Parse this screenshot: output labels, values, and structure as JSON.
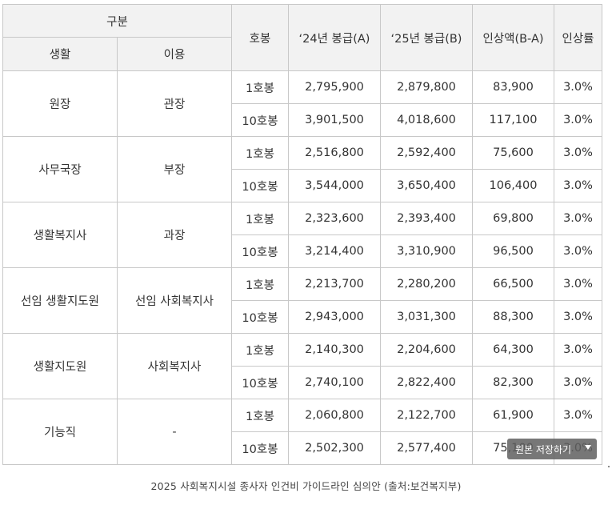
{
  "headers": {
    "group": "구분",
    "sub_life": "생활",
    "sub_use": "이용",
    "grade": "호봉",
    "pay_2024": "‘24년 봉급(A)",
    "pay_2025": "‘25년 봉급(B)",
    "increase": "인상액(B-A)",
    "rate": "인상률"
  },
  "rows": [
    {
      "life": "원장",
      "use": "관장",
      "steps": [
        {
          "grade": "1호봉",
          "a": "2,795,900",
          "b": "2,879,800",
          "inc": "83,900",
          "rate": "3.0%"
        },
        {
          "grade": "10호봉",
          "a": "3,901,500",
          "b": "4,018,600",
          "inc": "117,100",
          "rate": "3.0%"
        }
      ]
    },
    {
      "life": "사무국장",
      "use": "부장",
      "steps": [
        {
          "grade": "1호봉",
          "a": "2,516,800",
          "b": "2,592,400",
          "inc": "75,600",
          "rate": "3.0%"
        },
        {
          "grade": "10호봉",
          "a": "3,544,000",
          "b": "3,650,400",
          "inc": "106,400",
          "rate": "3.0%"
        }
      ]
    },
    {
      "life": "생활복지사",
      "use": "과장",
      "steps": [
        {
          "grade": "1호봉",
          "a": "2,323,600",
          "b": "2,393,400",
          "inc": "69,800",
          "rate": "3.0%"
        },
        {
          "grade": "10호봉",
          "a": "3,214,400",
          "b": "3,310,900",
          "inc": "96,500",
          "rate": "3.0%"
        }
      ]
    },
    {
      "life": "선임 생활지도원",
      "use": "선임 사회복지사",
      "steps": [
        {
          "grade": "1호봉",
          "a": "2,213,700",
          "b": "2,280,200",
          "inc": "66,500",
          "rate": "3.0%"
        },
        {
          "grade": "10호봉",
          "a": "2,943,000",
          "b": "3,031,300",
          "inc": "88,300",
          "rate": "3.0%"
        }
      ]
    },
    {
      "life": "생활지도원",
      "use": "사회복지사",
      "steps": [
        {
          "grade": "1호봉",
          "a": "2,140,300",
          "b": "2,204,600",
          "inc": "64,300",
          "rate": "3.0%"
        },
        {
          "grade": "10호봉",
          "a": "2,740,100",
          "b": "2,822,400",
          "inc": "82,300",
          "rate": "3.0%"
        }
      ]
    },
    {
      "life": "기능직",
      "use": "-",
      "steps": [
        {
          "grade": "1호봉",
          "a": "2,060,800",
          "b": "2,122,700",
          "inc": "61,900",
          "rate": "3.0%"
        },
        {
          "grade": "10호봉",
          "a": "2,502,300",
          "b": "2,577,400",
          "inc": "75,100",
          "rate": "3.0%"
        }
      ]
    }
  ],
  "caption": "2025 사회복지시설 종사자 인건비 가이드라인 심의안 (출처:보건복지부)",
  "save_button": "원본 저장하기"
}
